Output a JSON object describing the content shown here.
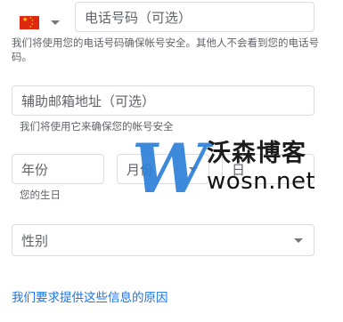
{
  "phone": {
    "placeholder": "电话号码（可选）",
    "helper": "我们将使用您的电话号码确保帐号安全。其他人不会看到您的电话号码。"
  },
  "recovery_email": {
    "placeholder": "辅助邮箱地址（可选）",
    "helper": "我们将使用它来确保您的帐号安全"
  },
  "birthday": {
    "year_placeholder": "年份",
    "month_placeholder": "月份",
    "day_placeholder": "日",
    "helper": "您的生日"
  },
  "gender": {
    "placeholder": "性别"
  },
  "why_link": "我们要求提供这些信息的原因",
  "watermark": {
    "letter": "W",
    "cn": "沃森博客",
    "en": "wosn.net"
  },
  "colors": {
    "link": "#1a73e8",
    "border": "#dadce0",
    "watermark_blue": "#2d7fd8"
  }
}
